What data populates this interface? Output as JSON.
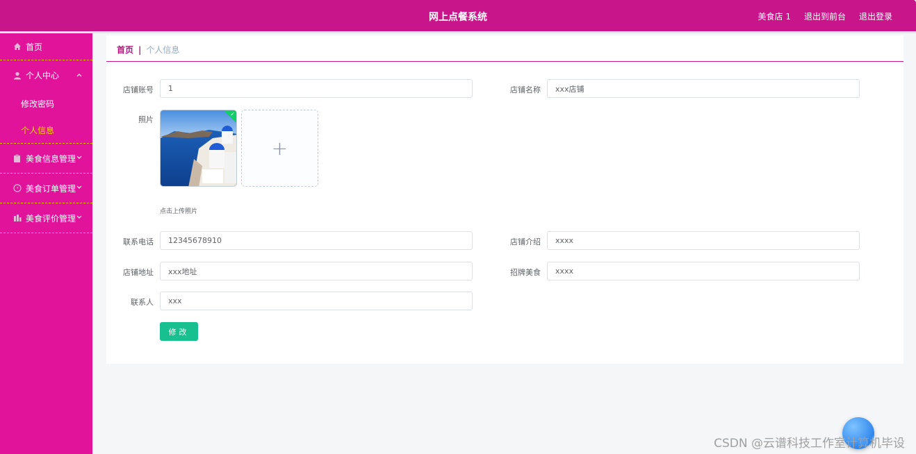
{
  "header": {
    "title": "网上点餐系统",
    "nav": [
      "美食店 1",
      "退出到前台",
      "退出登录"
    ]
  },
  "sidebar": {
    "items": [
      {
        "label": "首页",
        "icon": "home-icon"
      },
      {
        "label": "个人中心",
        "icon": "user-icon",
        "expanded": true,
        "children": [
          {
            "label": "修改密码"
          },
          {
            "label": "个人信息",
            "active": true
          }
        ]
      },
      {
        "label": "美食信息管理",
        "icon": "clipboard-icon"
      },
      {
        "label": "美食订单管理",
        "icon": "compass-icon"
      },
      {
        "label": "美食评价管理",
        "icon": "chart-icon"
      }
    ]
  },
  "breadcrumb": {
    "home": "首页",
    "separator": "|",
    "current": "个人信息"
  },
  "form": {
    "account_label": "店铺账号",
    "account_value": "1",
    "name_label": "店铺名称",
    "name_value": "xxx店铺",
    "photo_label": "照片",
    "upload_plus": "+",
    "upload_tip": "点击上传照片",
    "phone_label": "联系电话",
    "phone_value": "12345678910",
    "intro_label": "店铺介绍",
    "intro_value": "xxxx",
    "address_label": "店铺地址",
    "address_value": "xxx地址",
    "signature_label": "招牌美食",
    "signature_value": "xxxx",
    "contact_label": "联系人",
    "contact_value": "xxx",
    "submit_label": "修改"
  },
  "watermark": "CSDN @云谱科技工作室计算机毕设",
  "colors": {
    "header": "#c8158a",
    "sidebar": "#e0139a",
    "active": "#ffd900",
    "button": "#19c08f"
  }
}
